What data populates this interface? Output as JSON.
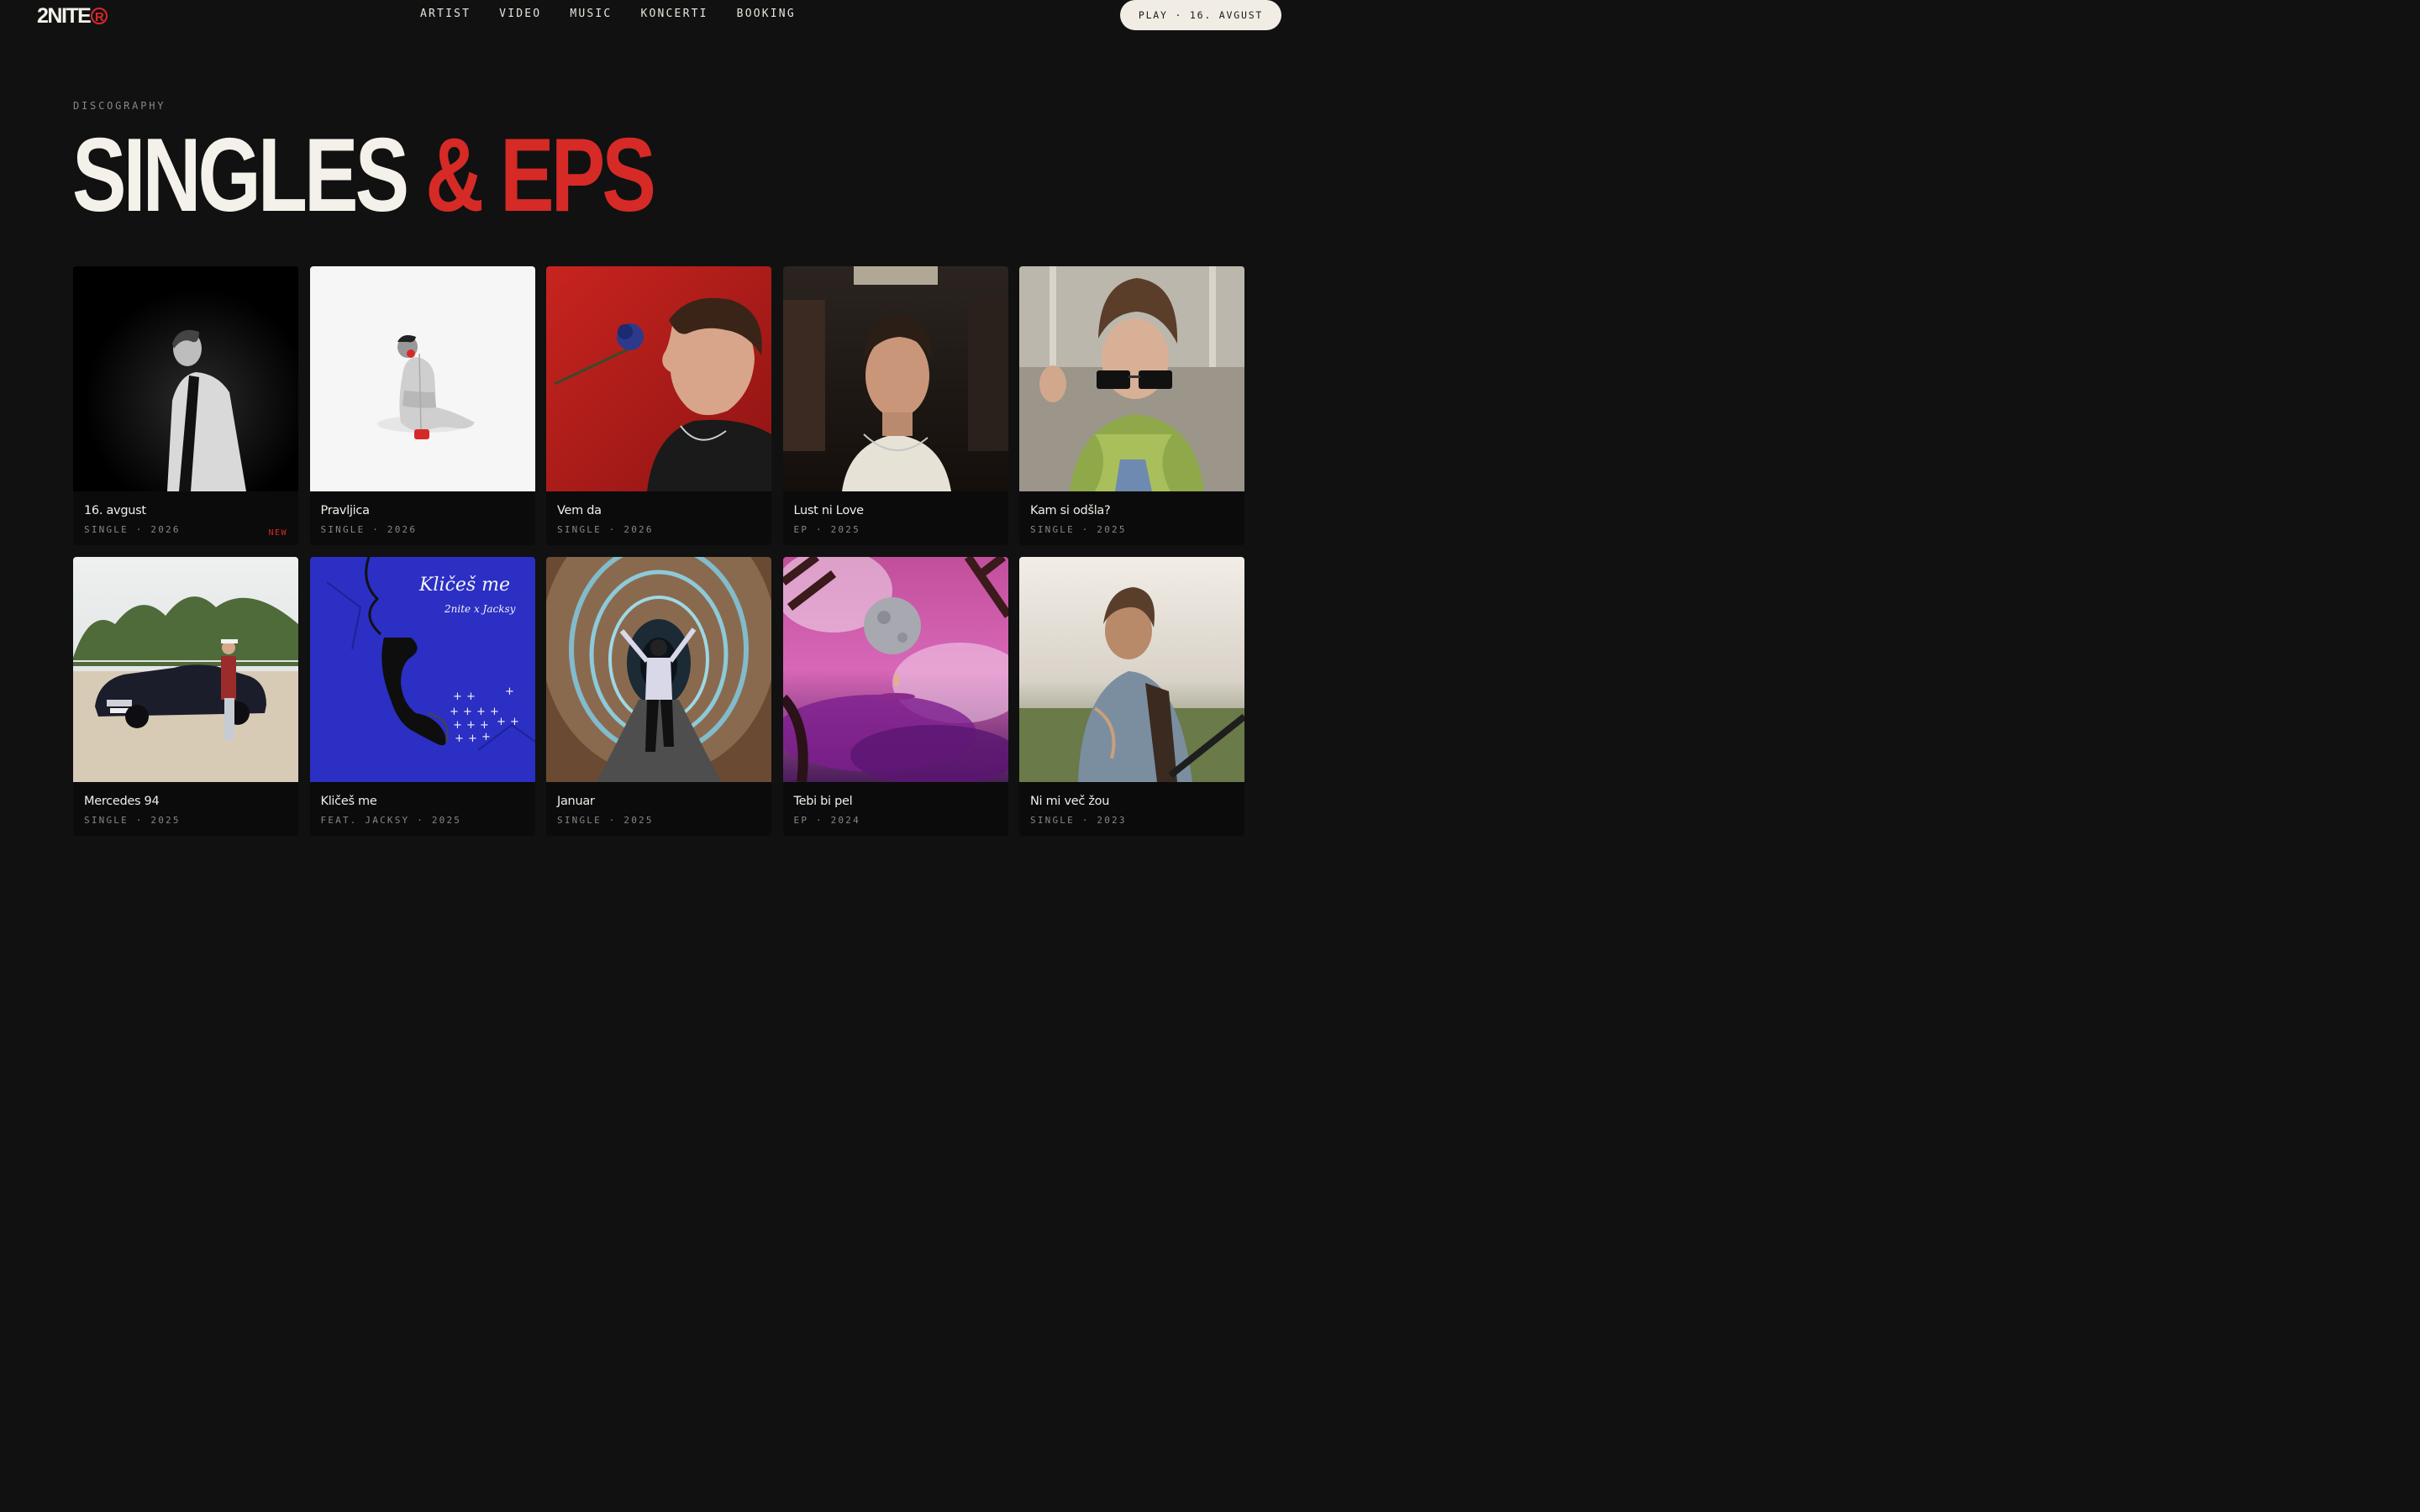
{
  "nav": {
    "logo": "2NITE",
    "logo_mark": "R",
    "links": [
      "ARTIST",
      "VIDEO",
      "MUSIC",
      "KONCERTI",
      "BOOKING"
    ],
    "play_button": "PLAY · 16. AVGUST"
  },
  "section": {
    "eyebrow": "DISCOGRAPHY",
    "title_white": "SINGLES",
    "title_red": "& EPS"
  },
  "releases": [
    {
      "title": "16. avgust",
      "meta": "SINGLE · 2026",
      "badge": "NEW"
    },
    {
      "title": "Pravljica",
      "meta": "SINGLE · 2026"
    },
    {
      "title": "Vem da",
      "meta": "SINGLE · 2026"
    },
    {
      "title": "Lust ni Love",
      "meta": "EP · 2025"
    },
    {
      "title": "Kam si odšla?",
      "meta": "SINGLE · 2025"
    },
    {
      "title": "Mercedes 94",
      "meta": "SINGLE · 2025"
    },
    {
      "title": "Kličeš me",
      "meta": "FEAT. JACKSY · 2025",
      "cover_text": "Kličeš me",
      "cover_subtext": "2nite x Jacksy"
    },
    {
      "title": "Januar",
      "meta": "SINGLE · 2025"
    },
    {
      "title": "Tebi bi pel",
      "meta": "EP · 2024"
    },
    {
      "title": "Ni mi več žou",
      "meta": "SINGLE · 2023"
    }
  ],
  "colors": {
    "background": "#111111",
    "accent": "#d62a27",
    "text": "#f2efe9",
    "muted": "#8a8782"
  }
}
